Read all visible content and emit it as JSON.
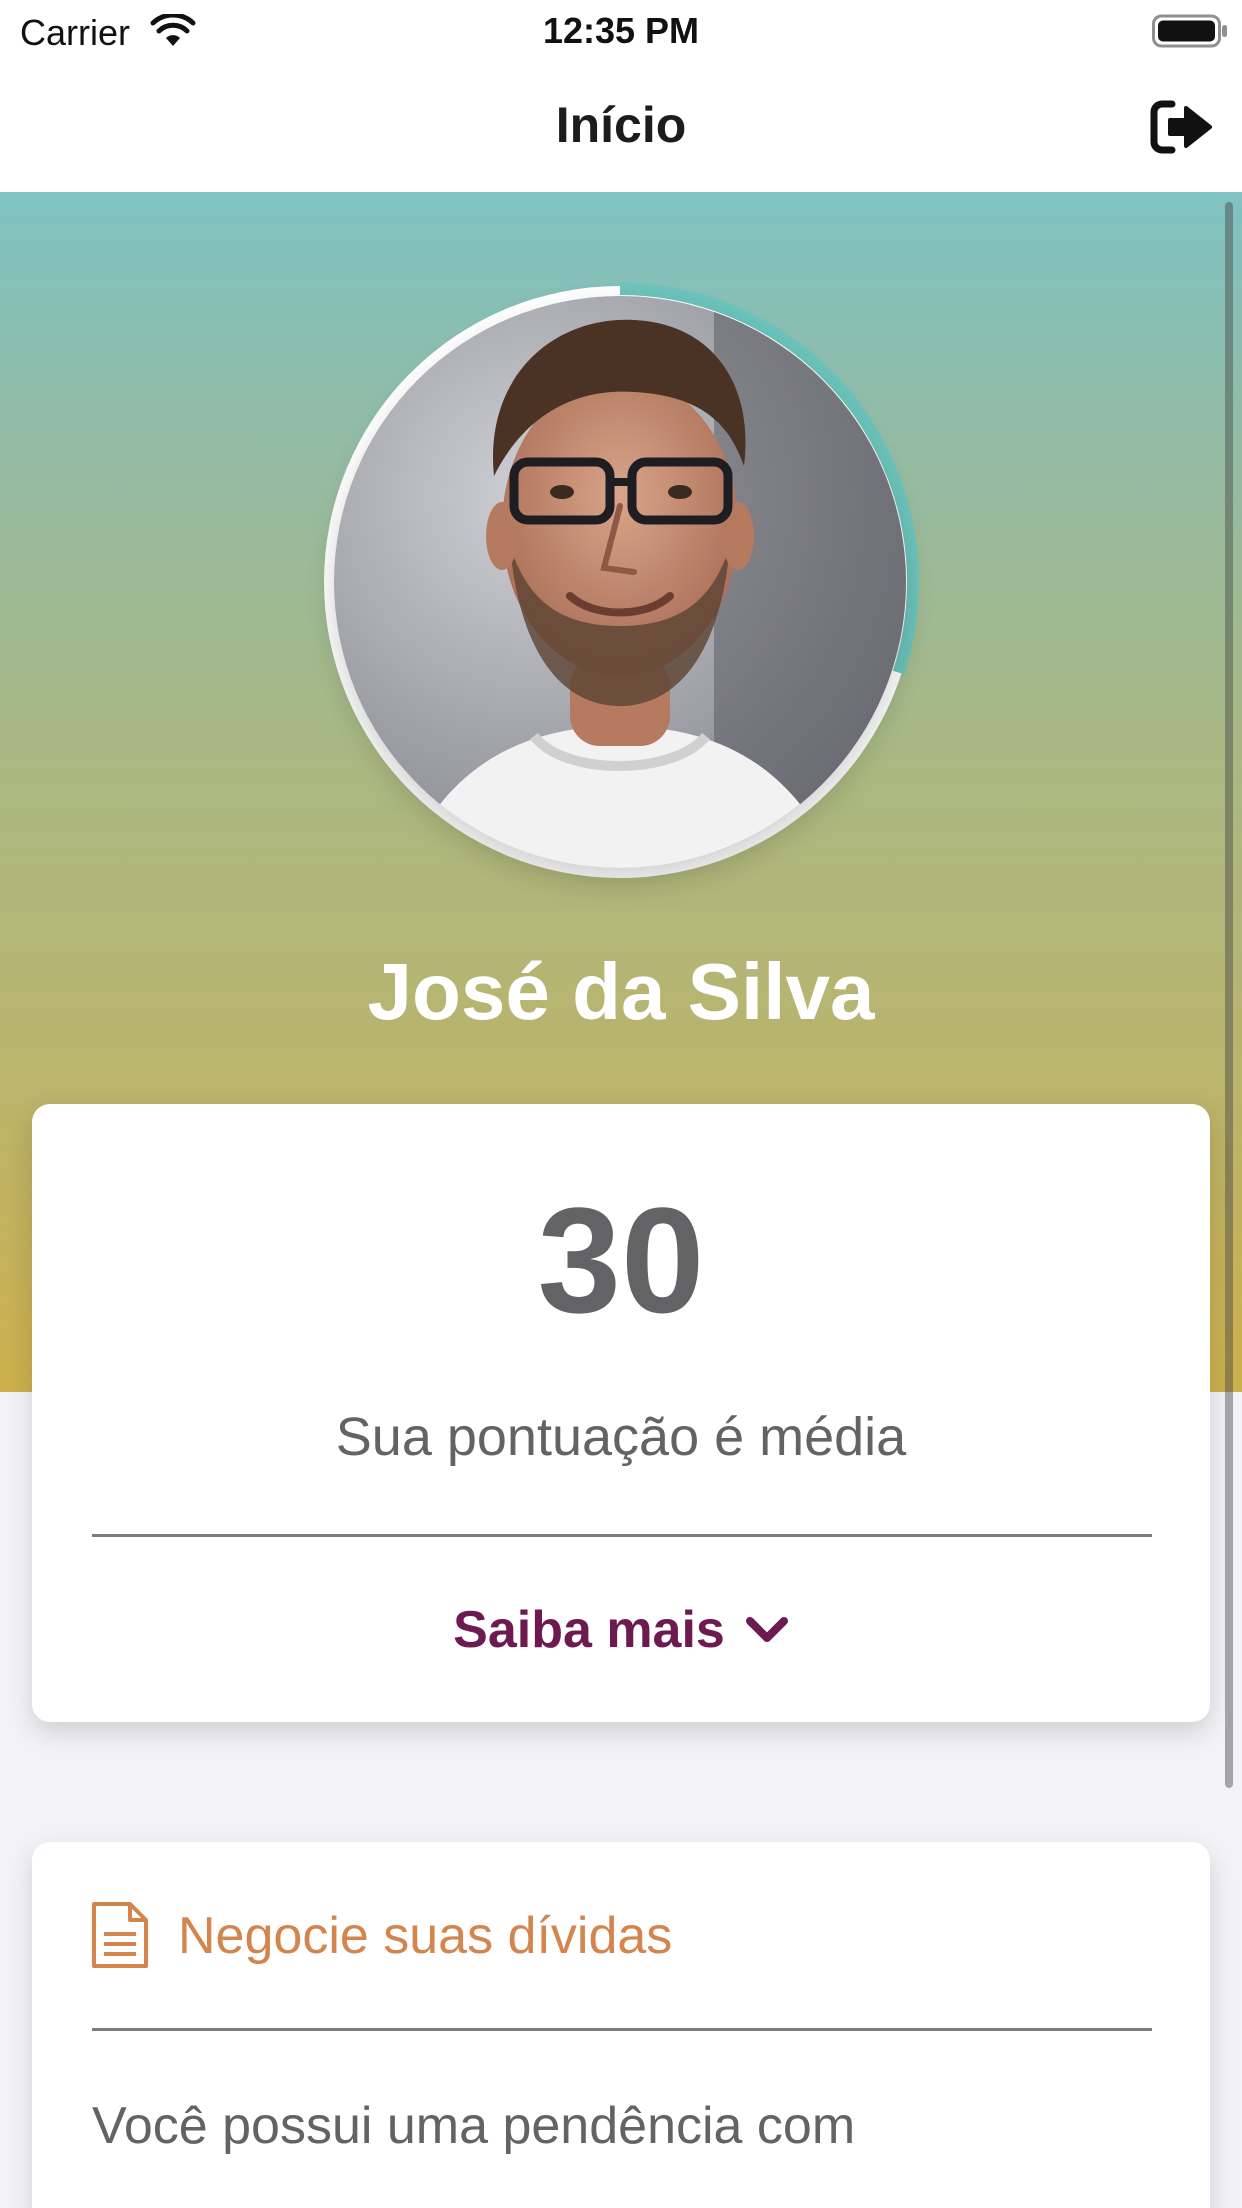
{
  "status_bar": {
    "carrier": "Carrier",
    "time": "12:35 PM"
  },
  "nav": {
    "title": "Início",
    "logout_icon": "logout-icon"
  },
  "profile": {
    "name": "José da Silva",
    "score_progress": 0.3,
    "gradient_colors": [
      "#7ec2c2",
      "#aab881",
      "#cdb04d"
    ]
  },
  "score_card": {
    "value": "30",
    "description": "Sua pontuação é média",
    "learn_more": "Saiba mais"
  },
  "debt_card": {
    "title": "Negocie suas dívidas",
    "text": "Você possui uma pendência com",
    "icon": "document-icon",
    "accent": "#d4854d"
  },
  "colors": {
    "ring_progress": "#6cc4bc",
    "learn_more": "#6c1a4f",
    "text_gray": "#636366"
  }
}
